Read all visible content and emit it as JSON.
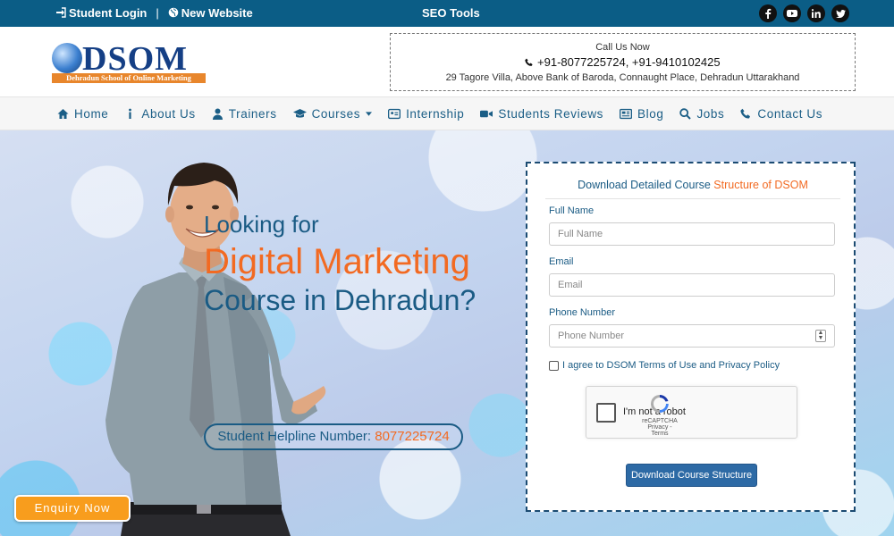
{
  "topbar": {
    "student_login": "Student Login",
    "separator": "|",
    "new_website": "New Website",
    "seo_tools": "SEO Tools",
    "social": [
      "facebook-icon",
      "youtube-icon",
      "linkedin-icon",
      "twitter-icon"
    ]
  },
  "header": {
    "logo_word": "DSOM",
    "logo_tagline": "Dehradun School of Online Marketing",
    "call_label": "Call Us Now",
    "phones": "+91-8077225724, +91-9410102425",
    "address": "29 Tagore Villa, Above Bank of Baroda, Connaught Place, Dehradun Uttarakhand"
  },
  "nav": {
    "items": [
      {
        "label": "Home",
        "icon": "home-icon"
      },
      {
        "label": "About Us",
        "icon": "info-icon"
      },
      {
        "label": "Trainers",
        "icon": "user-icon"
      },
      {
        "label": "Courses",
        "icon": "graduation-cap-icon"
      },
      {
        "label": "Internship",
        "icon": "id-card-icon"
      },
      {
        "label": "Students Reviews",
        "icon": "video-icon"
      },
      {
        "label": "Blog",
        "icon": "newspaper-icon"
      },
      {
        "label": "Jobs",
        "icon": "search-icon"
      },
      {
        "label": "Contact Us",
        "icon": "phone-icon"
      }
    ]
  },
  "hero": {
    "line1": "Looking for",
    "line2": "Digital Marketing",
    "line3": "Course in Dehradun?",
    "helpline_label": "Student Helpline Number:",
    "helpline_number": "8077225724",
    "enquiry": "Enquiry Now"
  },
  "form": {
    "title_blue": "Download Detailed Course",
    "title_orange": "Structure of DSOM",
    "full_name_label": "Full Name",
    "full_name_placeholder": "Full Name",
    "email_label": "Email",
    "email_placeholder": "Email",
    "phone_label": "Phone Number",
    "phone_placeholder": "Phone Number",
    "agree": "I agree to DSOM Terms of Use and Privacy Policy",
    "recaptcha_text": "I'm not a robot",
    "recaptcha_brand": "reCAPTCHA",
    "recaptcha_links": "Privacy - Terms",
    "submit": "Download Course Structure"
  },
  "colors": {
    "topbar": "#0b5d86",
    "brand_blue": "#1a5b84",
    "accent_orange": "#f26a22",
    "button_blue": "#2d6aa5",
    "enquiry_orange": "#f89d1d"
  }
}
